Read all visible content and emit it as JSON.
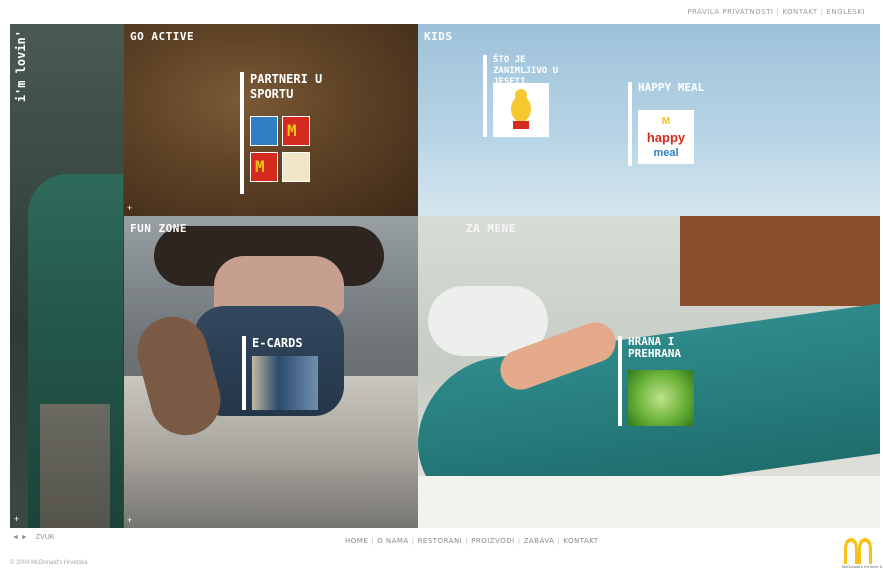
{
  "top_links": [
    "PRAVILA PRIVATNOSTI",
    "KONTAKT",
    "ENGLESKI"
  ],
  "left_panel": {
    "vertical_text": "i'm lovin'"
  },
  "panels": {
    "go_active": {
      "title": "GO ACTIVE"
    },
    "kids": {
      "title": "KIDS"
    },
    "fun_zone": {
      "title": "FUN ZONE"
    },
    "relax": {
      "title": "ZA MENE"
    }
  },
  "tiles": {
    "partneri": {
      "label": "PARTNERI U SPORTU"
    },
    "sto_od_sto": {
      "label": "ŠTO JE ZANIMLJIVO U JESETI"
    },
    "happy_meal": {
      "label": "HAPPY MEAL"
    },
    "ecards": {
      "label": "E-CARDS"
    },
    "hrana": {
      "label": "HRANA I PREHRANA"
    }
  },
  "bottom_left": [
    "◄",
    "►",
    "ZVUK"
  ],
  "bottom_links": [
    "HOME",
    "O NAMA",
    "RESTORANI",
    "PROIZVODI",
    "ZABAVA",
    "KONTAKT"
  ],
  "copyright": "© 2004 McDonald's Hrvatska",
  "brand": {
    "logo_tagline": "McDonald's i'm lovin' it",
    "gold": "#f6c21a",
    "red": "#d52b1e"
  }
}
